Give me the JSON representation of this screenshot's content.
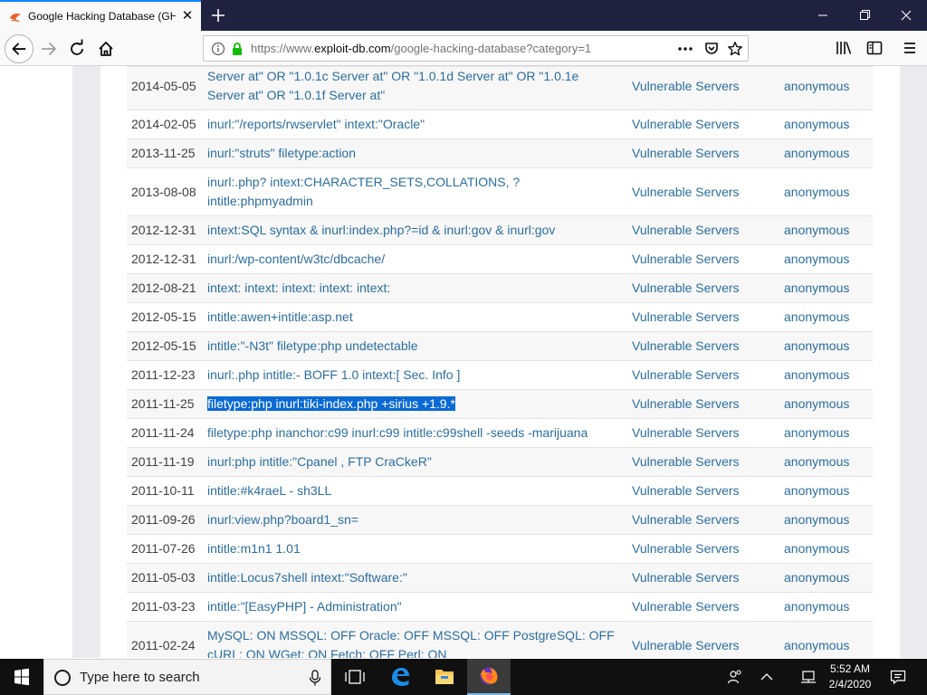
{
  "browser": {
    "tab_title": "Google Hacking Database (GHDB)",
    "url_prefix": "https://www.",
    "url_host": "exploit-db.com",
    "url_path": "/google-hacking-database?category=1",
    "accent_color": "#0a84ff"
  },
  "table": {
    "rows": [
      {
        "date": "2014-05-05",
        "dork": "Server at\" OR \"1.0.1c Server at\" OR \"1.0.1d Server at\" OR \"1.0.1e Server at\" OR \"1.0.1f Server at\"",
        "category": "Vulnerable Servers",
        "author": "anonymous"
      },
      {
        "date": "2014-02-05",
        "dork": "inurl:\"/reports/rwservlet\" intext:\"Oracle\"",
        "category": "Vulnerable Servers",
        "author": "anonymous"
      },
      {
        "date": "2013-11-25",
        "dork": "inurl:\"struts\" filetype:action",
        "category": "Vulnerable Servers",
        "author": "anonymous"
      },
      {
        "date": "2013-08-08",
        "dork": "inurl:.php? intext:CHARACTER_SETS,COLLATIONS, ?intitle:phpmyadmin",
        "category": "Vulnerable Servers",
        "author": "anonymous"
      },
      {
        "date": "2012-12-31",
        "dork": "intext:SQL syntax & inurl:index.php?=id & inurl:gov & inurl:gov",
        "category": "Vulnerable Servers",
        "author": "anonymous"
      },
      {
        "date": "2012-12-31",
        "dork": "inurl:/wp-content/w3tc/dbcache/",
        "category": "Vulnerable Servers",
        "author": "anonymous"
      },
      {
        "date": "2012-08-21",
        "dork": "intext: intext: intext: intext: intext:",
        "category": "Vulnerable Servers",
        "author": "anonymous"
      },
      {
        "date": "2012-05-15",
        "dork": "intitle:awen+intitle:asp.net",
        "category": "Vulnerable Servers",
        "author": "anonymous"
      },
      {
        "date": "2012-05-15",
        "dork": "intitle:\"-N3t\" filetype:php undetectable",
        "category": "Vulnerable Servers",
        "author": "anonymous"
      },
      {
        "date": "2011-12-23",
        "dork": "inurl:.php intitle:- BOFF 1.0 intext:[ Sec. Info ]",
        "category": "Vulnerable Servers",
        "author": "anonymous"
      },
      {
        "date": "2011-11-25",
        "dork": "filetype:php inurl:tiki-index.php +sirius +1.9.*",
        "category": "Vulnerable Servers",
        "author": "anonymous",
        "selected": true
      },
      {
        "date": "2011-11-24",
        "dork": "filetype:php inanchor:c99 inurl:c99 intitle:c99shell -seeds -marijuana",
        "category": "Vulnerable Servers",
        "author": "anonymous"
      },
      {
        "date": "2011-11-19",
        "dork": "inurl:php intitle:\"Cpanel , FTP CraCkeR\"",
        "category": "Vulnerable Servers",
        "author": "anonymous"
      },
      {
        "date": "2011-10-11",
        "dork": "intitle:#k4raeL - sh3LL",
        "category": "Vulnerable Servers",
        "author": "anonymous"
      },
      {
        "date": "2011-09-26",
        "dork": "inurl:view.php?board1_sn=",
        "category": "Vulnerable Servers",
        "author": "anonymous"
      },
      {
        "date": "2011-07-26",
        "dork": "intitle:m1n1 1.01",
        "category": "Vulnerable Servers",
        "author": "anonymous"
      },
      {
        "date": "2011-05-03",
        "dork": "intitle:Locus7shell intext:\"Software:\"",
        "category": "Vulnerable Servers",
        "author": "anonymous"
      },
      {
        "date": "2011-03-23",
        "dork": "intitle:\"[EasyPHP] - Administration\"",
        "category": "Vulnerable Servers",
        "author": "anonymous"
      },
      {
        "date": "2011-02-24",
        "dork": "MySQL: ON MSSQL: OFF Oracle: OFF MSSQL: OFF PostgreSQL: OFF cURL: ON WGet: ON Fetch: OFF Perl: ON",
        "category": "Vulnerable Servers",
        "author": "anonymous"
      }
    ]
  },
  "taskbar": {
    "search_placeholder": "Type here to search",
    "time": "5:52 AM",
    "date": "2/4/2020"
  }
}
